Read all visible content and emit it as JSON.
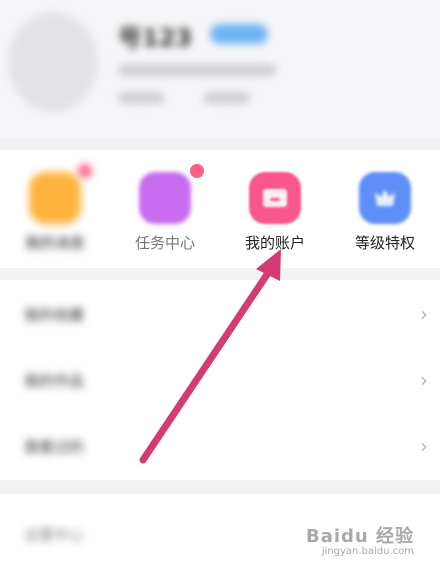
{
  "profile": {
    "name": "号123",
    "subtitle": "",
    "meta": [
      "",
      ""
    ]
  },
  "shortcuts": [
    {
      "label": "我的消息",
      "icon": "message-icon",
      "color": "#ffb33d",
      "has_dot": true
    },
    {
      "label": "任务中心",
      "icon": "calendar-check-icon",
      "color": "#c96cf0",
      "has_dot": true
    },
    {
      "label": "我的账户",
      "icon": "folder-icon",
      "color": "#f7578c",
      "has_dot": false
    },
    {
      "label": "等级特权",
      "icon": "crown-icon",
      "color": "#5e8ef7",
      "has_dot": false
    }
  ],
  "list": [
    {
      "label": "我的收藏"
    },
    {
      "label": "我的作品"
    },
    {
      "label": "我看过的"
    }
  ],
  "bottom": {
    "label": "设置中心"
  },
  "chevron": "›",
  "watermark": {
    "text": "Baidu 经验",
    "sub": "jingyan.baidu.com"
  },
  "annotation_color": "#d63a75"
}
